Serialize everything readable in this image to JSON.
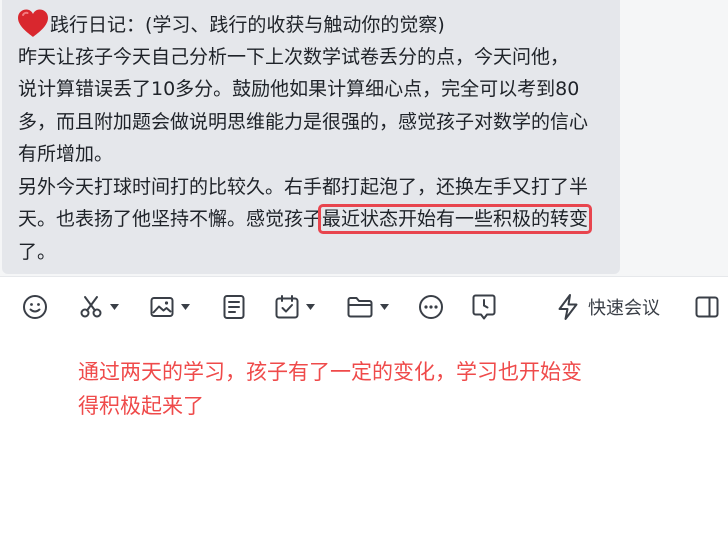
{
  "message": {
    "heart_icon": "red-heart-emoji",
    "line0": "践行日记：(学习、践行的收获与触动你的觉察)",
    "line1": "昨天让孩子今天自己分析一下上次数学试卷丢分的点，今天问他，",
    "line2": "说计算错误丢了10多分。鼓励他如果计算细心点，完全可以考到80",
    "line3": "多，而且附加题会做说明思维能力是很强的，感觉孩子对数学的信心",
    "line4": "有所增加。",
    "line5": "另外今天打球时间打的比较久。右手都打起泡了，还换左手又打了半",
    "line6_before": "天。也表扬了他坚持不懈。感觉孩子",
    "line6_highlight": "最近状态开始有一些积极的转变",
    "line7": "了。",
    "highlight_color": "#e8454e"
  },
  "toolbar": {
    "emoji_icon": "smiley-icon",
    "screenshot_icon": "scissors-icon",
    "image_icon": "image-icon",
    "doc_icon": "document-icon",
    "task_icon": "calendar-check-icon",
    "folder_icon": "folder-icon",
    "more_icon": "more-dots-icon",
    "schedule_icon": "clock-message-icon",
    "meeting_icon": "lightning-icon",
    "meeting_label": "快速会议",
    "panel_icon": "side-panel-icon"
  },
  "editor": {
    "draft_line1": "通过两天的学习，孩子有了一定的变化，学习也开始变",
    "draft_line2": "得积极起来了",
    "draft_color": "#ef4a4a"
  }
}
